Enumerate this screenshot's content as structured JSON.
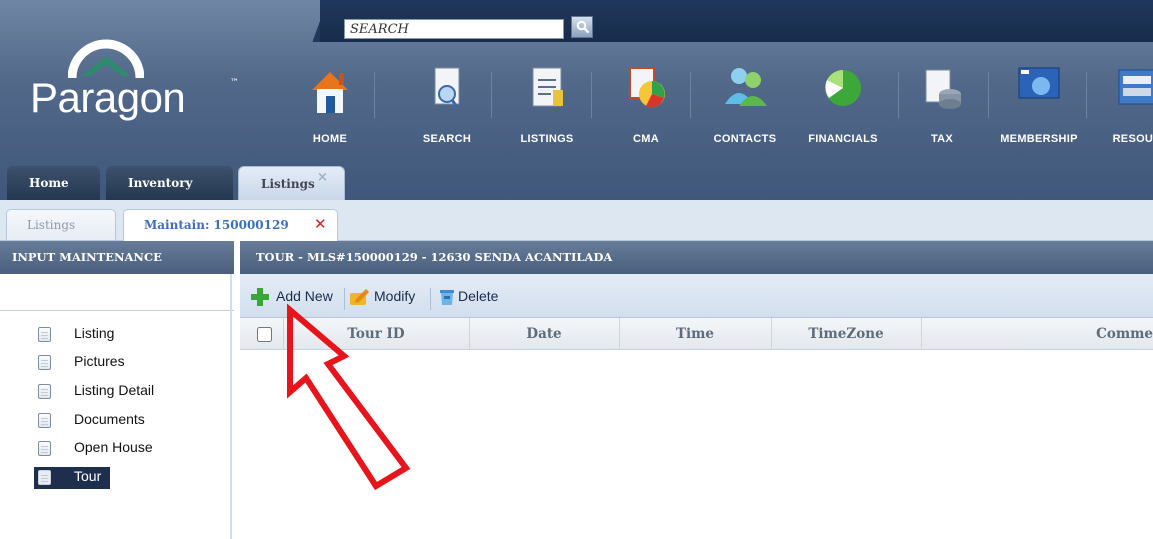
{
  "search": {
    "placeholder": "SEARCH"
  },
  "logo": {
    "text": "Paragon",
    "tm": "™"
  },
  "nav": [
    {
      "label": "HOME",
      "icon": "home-icon"
    },
    {
      "label": "SEARCH",
      "icon": "search-document-icon"
    },
    {
      "label": "LISTINGS",
      "icon": "listings-icon"
    },
    {
      "label": "CMA",
      "icon": "cma-icon"
    },
    {
      "label": "CONTACTS",
      "icon": "contacts-icon"
    },
    {
      "label": "FINANCIALS",
      "icon": "financials-icon"
    },
    {
      "label": "TAX",
      "icon": "tax-icon"
    },
    {
      "label": "MEMBERSHIP",
      "icon": "membership-icon"
    },
    {
      "label": "RESOUR",
      "icon": "resources-icon"
    }
  ],
  "main_tabs": [
    {
      "label": "Home"
    },
    {
      "label": "Inventory"
    },
    {
      "label": "Listings",
      "close": "×",
      "active": true
    }
  ],
  "sub_tabs": [
    {
      "label": "Listings"
    },
    {
      "label": "Maintain: 150000129",
      "close": "✕",
      "active": true
    }
  ],
  "left_panel": {
    "title": "INPUT MAINTENANCE",
    "items": [
      {
        "label": "Listing"
      },
      {
        "label": "Pictures"
      },
      {
        "label": "Listing Detail"
      },
      {
        "label": "Documents"
      },
      {
        "label": "Open House"
      },
      {
        "label": "Tour",
        "selected": true
      }
    ]
  },
  "right_panel": {
    "title": "TOUR - MLS#150000129 - 12630 SENDA ACANTILADA",
    "toolbar": {
      "add_new": "Add New",
      "modify": "Modify",
      "delete": "Delete"
    },
    "columns": [
      "Tour ID",
      "Date",
      "Time",
      "TimeZone",
      "Comme"
    ]
  },
  "colors": {
    "header_dark": "#1d3354",
    "header_mid": "#4f6688",
    "annotation_arrow": "#e8141b",
    "selected_item": "#1e2f4e",
    "maintain_tab_text": "#3d6fbc"
  }
}
